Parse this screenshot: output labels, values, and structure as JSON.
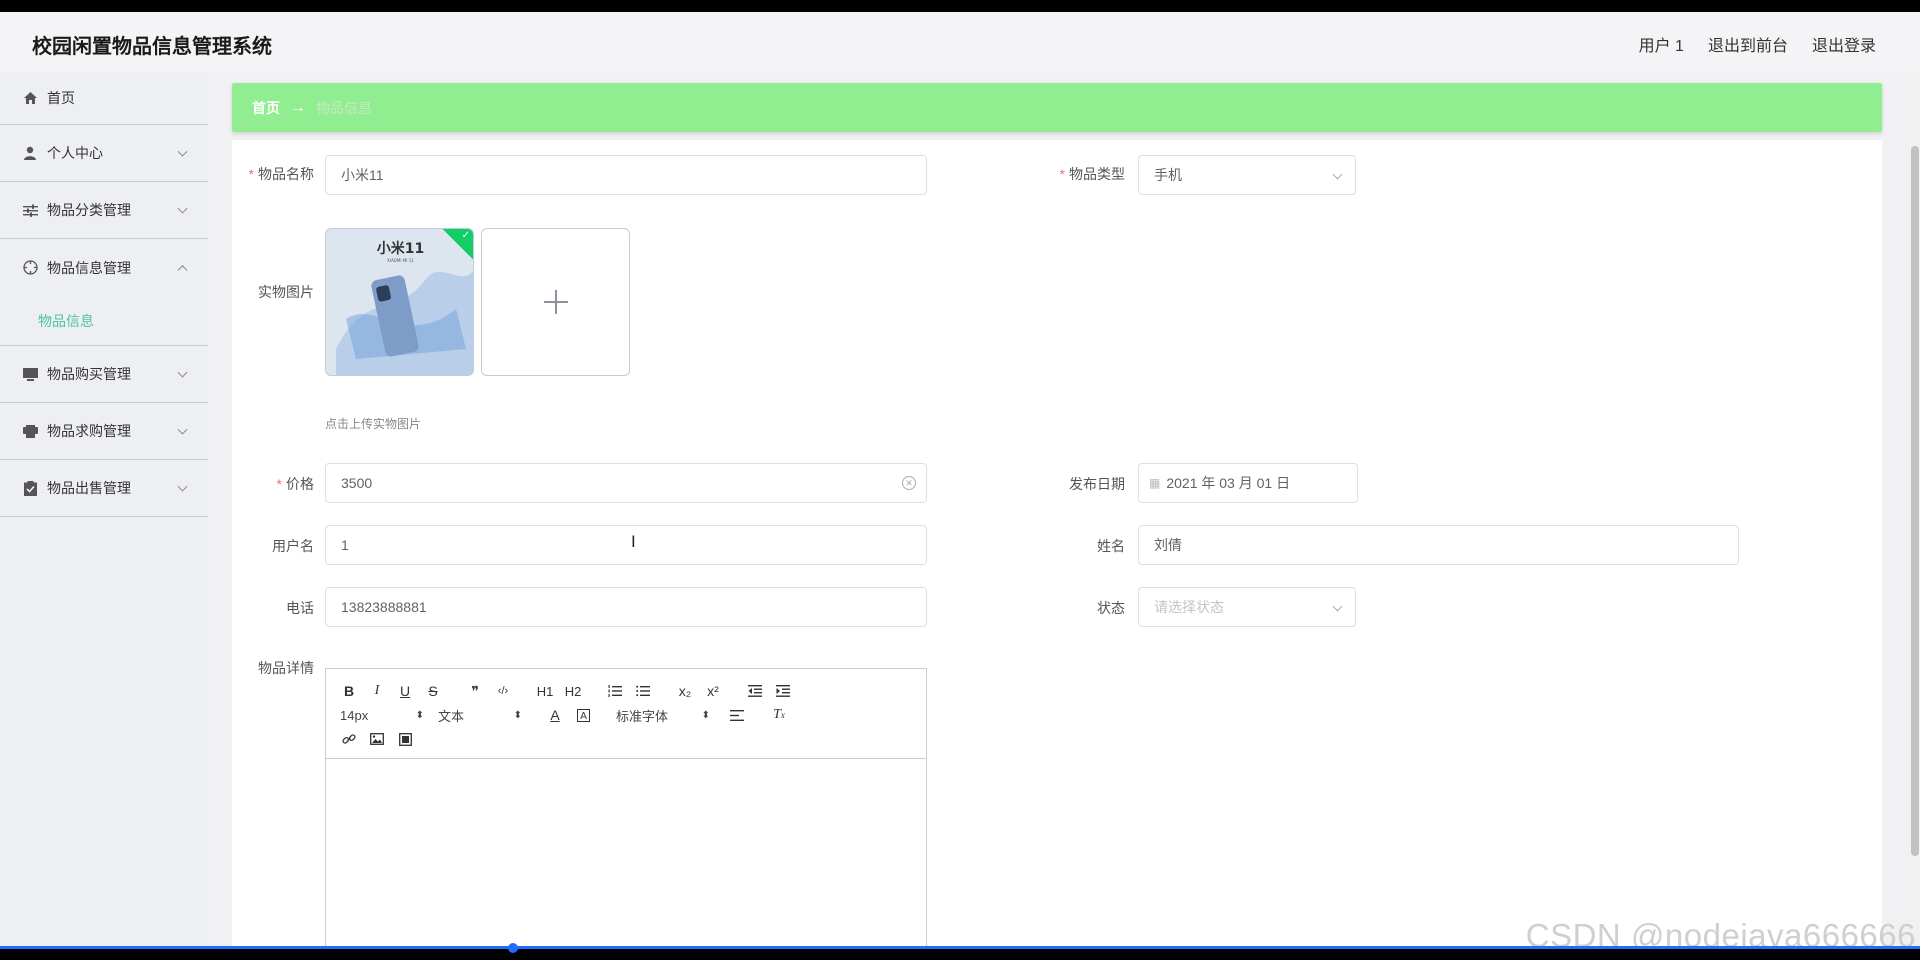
{
  "app": {
    "title": "校园闲置物品信息管理系统"
  },
  "header": {
    "user_label": "用户 1",
    "front_link": "退出到前台",
    "logout": "退出登录"
  },
  "sidebar": {
    "items": [
      {
        "label": "首页",
        "icon": "home-icon"
      },
      {
        "label": "个人中心",
        "icon": "user-icon"
      },
      {
        "label": "物品分类管理",
        "icon": "sliders-icon"
      },
      {
        "label": "物品信息管理",
        "icon": "compass-icon",
        "sub_label": "物品信息"
      },
      {
        "label": "物品购买管理",
        "icon": "monitor-icon"
      },
      {
        "label": "物品求购管理",
        "icon": "printer-icon"
      },
      {
        "label": "物品出售管理",
        "icon": "clipboard-icon"
      }
    ]
  },
  "breadcrumb": {
    "home": "首页",
    "arrow": "→",
    "current": "物品信息"
  },
  "form": {
    "item_name": {
      "label": "物品名称",
      "value": "小米11"
    },
    "item_type": {
      "label": "物品类型",
      "value": "手机"
    },
    "photo": {
      "label": "实物图片",
      "hint": "点击上传实物图片",
      "thumb_brand": "小米11",
      "thumb_sub": "XIAOMI MI 11"
    },
    "price": {
      "label": "价格",
      "value": "3500"
    },
    "publish_date": {
      "label": "发布日期",
      "value": "2021 年 03 月 01 日"
    },
    "username": {
      "label": "用户名",
      "value": "1"
    },
    "realname": {
      "label": "姓名",
      "value": "刘倩"
    },
    "phone": {
      "label": "电话",
      "value": "13823888881"
    },
    "status": {
      "label": "状态",
      "placeholder": "请选择状态"
    },
    "details": {
      "label": "物品详情"
    }
  },
  "editor": {
    "font_size": "14px",
    "block_type": "文本",
    "font_family": "标准字体",
    "buttons": {
      "bold": "B",
      "italic": "I",
      "underline": "U",
      "strike": "S",
      "quote": "❞",
      "code": "‹/›",
      "h1": "H1",
      "h2": "H2",
      "sub": "x₂",
      "sup": "x²"
    }
  },
  "watermark": "CSDN @nodejava666666",
  "colors": {
    "accent": "#90ee90",
    "active_text": "#4cc5a0",
    "required": "#f56c6c",
    "upload_success": "#13ce66"
  }
}
